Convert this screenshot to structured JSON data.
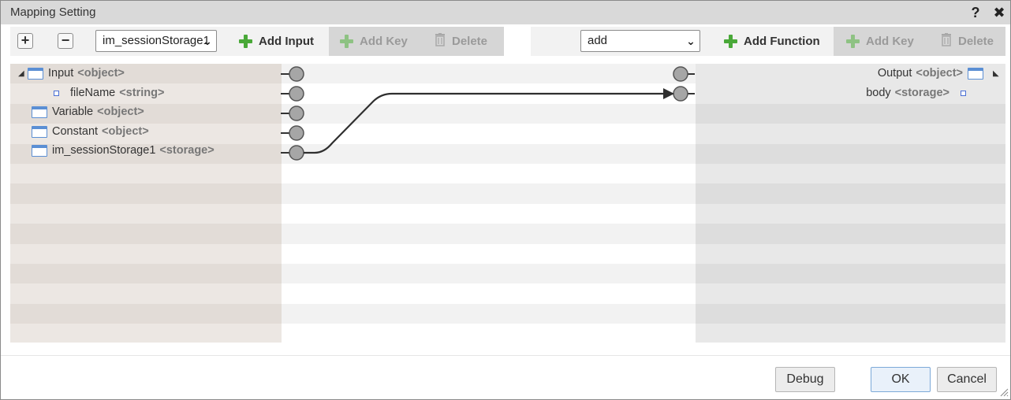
{
  "dialog": {
    "title": "Mapping Setting",
    "help": "?",
    "close": "✖"
  },
  "toolbar": {
    "expand_symbol": "+",
    "collapse_symbol": "−",
    "input_select": {
      "value": "im_sessionStorage1"
    },
    "add_input_label": "Add Input",
    "left_add_key_label": "Add Key",
    "left_delete_label": "Delete",
    "function_select": {
      "value": "add"
    },
    "add_function_label": "Add Function",
    "right_add_key_label": "Add Key",
    "right_delete_label": "Delete"
  },
  "input_tree": [
    {
      "name": "Input",
      "type": "<object>",
      "icon": "object-icon",
      "expanded": true
    },
    {
      "name": "fileName",
      "type": "<string>",
      "icon": "field-icon"
    },
    {
      "name": "Variable",
      "type": "<object>",
      "icon": "object-icon"
    },
    {
      "name": "Constant",
      "type": "<object>",
      "icon": "object-icon"
    },
    {
      "name": "im_sessionStorage1",
      "type": "<storage>",
      "icon": "object-icon"
    }
  ],
  "output_tree": [
    {
      "name": "Output",
      "type": "<object>",
      "icon": "object-icon",
      "expanded": true
    },
    {
      "name": "body",
      "type": "<storage>",
      "icon": "field-icon"
    }
  ],
  "mapping": {
    "from": "im_sessionStorage1",
    "to": "body"
  },
  "footer": {
    "debug_label": "Debug",
    "ok_label": "OK",
    "cancel_label": "Cancel"
  },
  "colors": {
    "link_line": "#333333",
    "connector_fill": "#a6a6a6",
    "add_icon": "#49a838",
    "object_icon": "#5b8fd4"
  }
}
